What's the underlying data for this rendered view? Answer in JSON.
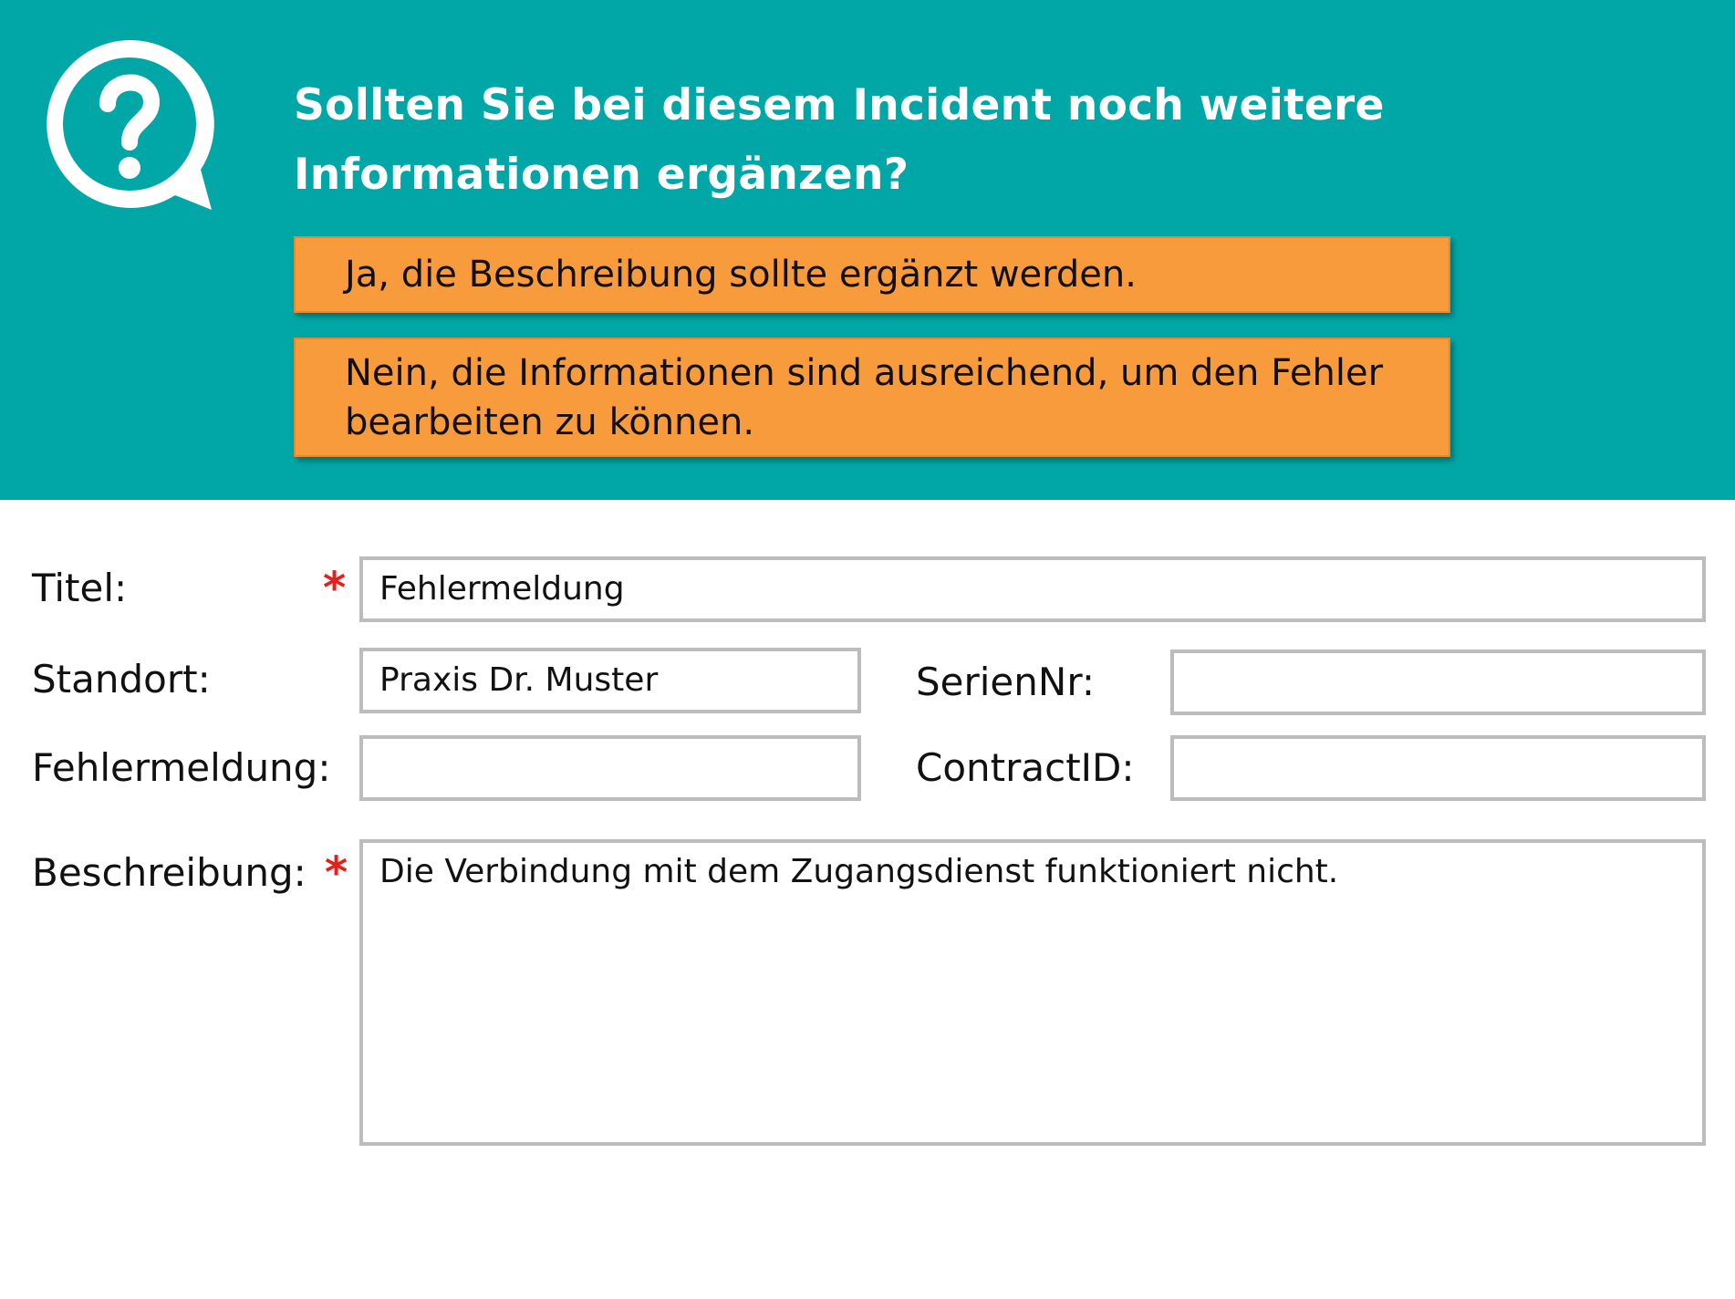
{
  "question": {
    "title": "Sollten Sie bei diesem Incident noch weitere Informationen ergänzen?",
    "answers": [
      "Ja, die Beschreibung sollte ergänzt werden.",
      "Nein, die Informationen sind ausreichend, um den Fehler bearbeiten zu können."
    ],
    "icon": "question-bubble-icon"
  },
  "form": {
    "required_marker": "*",
    "titel": {
      "label": "Titel:",
      "value": "Fehlermeldung"
    },
    "standort": {
      "label": "Standort:",
      "value": "Praxis Dr. Muster"
    },
    "seriennr": {
      "label": "SerienNr:",
      "value": ""
    },
    "fehlermeldung": {
      "label": "Fehlermeldung:",
      "value": ""
    },
    "contractid": {
      "label": "ContractID:",
      "value": ""
    },
    "beschreibung": {
      "label": "Beschreibung:",
      "value": "Die Verbindung mit dem Zugangsdienst funktioniert nicht."
    }
  },
  "colors": {
    "header_background": "#00a7a6",
    "answer_button": "#f89b3d",
    "required_star": "#e3201b",
    "field_border": "#bcbcbc"
  }
}
